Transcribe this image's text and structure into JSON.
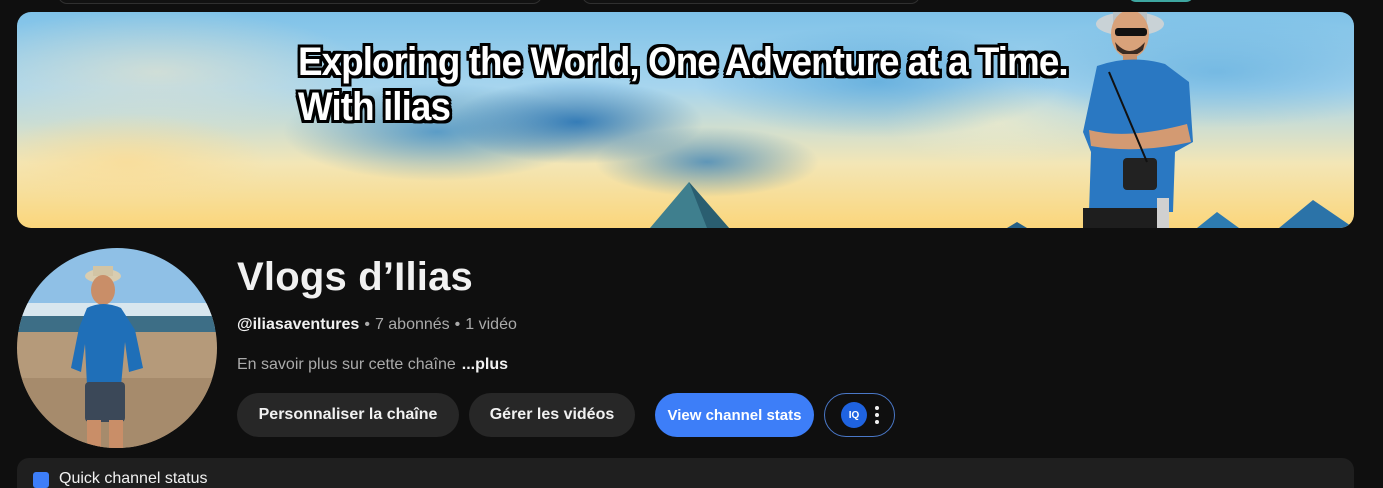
{
  "banner": {
    "line1": "Exploring the World, One Adventure at a Time.",
    "line2": "With ilias"
  },
  "channel": {
    "name": "Vlogs d’Ilias",
    "handle": "@iliasaventures",
    "subscribers": "7 abonnés",
    "videos": "1 vidéo",
    "separator": "•",
    "description": "En savoir plus sur cette chaîne",
    "more_label": "...plus"
  },
  "actions": {
    "customize_label": "Personnaliser la chaîne",
    "manage_videos_label": "Gérer les vidéos",
    "stats_label": "View channel stats",
    "iq_logo_text": "IQ"
  },
  "bottom_bar": {
    "text": "Quick channel status"
  },
  "colors": {
    "background": "#0f0f0f",
    "button_grey": "#272727",
    "accent_blue": "#3d7ef8",
    "muted_text": "#aaaaaa"
  }
}
